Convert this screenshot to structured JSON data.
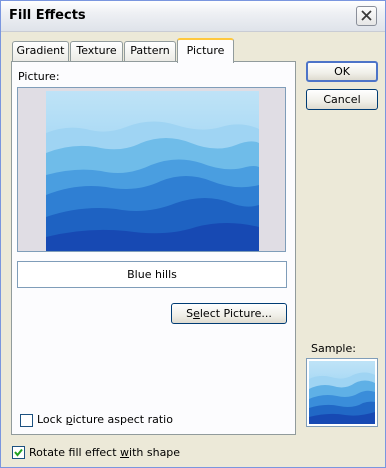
{
  "window": {
    "title": "Fill Effects"
  },
  "tabs": [
    {
      "label": "Gradient"
    },
    {
      "label": "Texture"
    },
    {
      "label": "Pattern"
    },
    {
      "label": "Picture"
    }
  ],
  "picture_tab": {
    "picture_label": "Picture:",
    "picture_name": "Blue hills",
    "select_picture_button": {
      "before": "S",
      "accel": "e",
      "after": "lect Picture..."
    },
    "lock_aspect": {
      "before": "Lock ",
      "accel": "p",
      "after": "icture aspect ratio",
      "checked": false
    }
  },
  "buttons": {
    "ok": "OK",
    "cancel": "Cancel"
  },
  "sample_label": "Sample:",
  "rotate_fill": {
    "before": "Rotate fill effect ",
    "accel": "w",
    "after": "ith shape",
    "checked": true
  },
  "colors": {
    "sky_top": "#bfe3f7",
    "hills_dark": "#1749b3"
  }
}
